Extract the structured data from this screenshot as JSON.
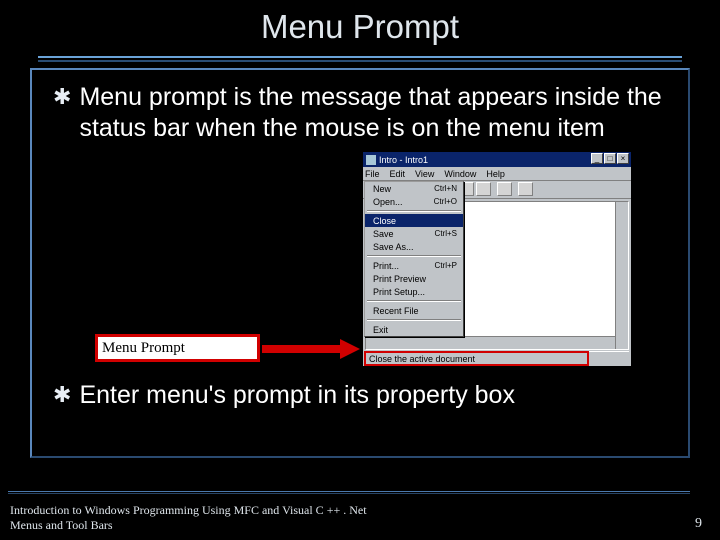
{
  "title": "Menu Prompt",
  "bullets": [
    "Menu prompt is the message that appears inside the status bar when the mouse is on the menu item",
    "Enter menu's prompt in its property box"
  ],
  "callout_label": "Menu Prompt",
  "window": {
    "title": "Intro - Intro1",
    "controls": {
      "min": "_",
      "max": "□",
      "close": "×"
    },
    "menus": [
      "File",
      "Edit",
      "View",
      "Window",
      "Help"
    ],
    "dropdown": [
      {
        "label": "New",
        "shortcut": "Ctrl+N"
      },
      {
        "label": "Open...",
        "shortcut": "Ctrl+O"
      },
      {
        "sep": true
      },
      {
        "label": "Close",
        "selected": true
      },
      {
        "label": "Save",
        "shortcut": "Ctrl+S"
      },
      {
        "label": "Save As..."
      },
      {
        "sep": true
      },
      {
        "label": "Print...",
        "shortcut": "Ctrl+P"
      },
      {
        "label": "Print Preview"
      },
      {
        "label": "Print Setup..."
      },
      {
        "sep": true
      },
      {
        "label": "Recent File"
      },
      {
        "sep": true
      },
      {
        "label": "Exit"
      }
    ],
    "status_text": "Close the active document"
  },
  "footer": {
    "line1": "Introduction to Windows Programming Using MFC and Visual C ++ . Net",
    "line2": "Menus and Tool Bars"
  },
  "page_number": "9"
}
